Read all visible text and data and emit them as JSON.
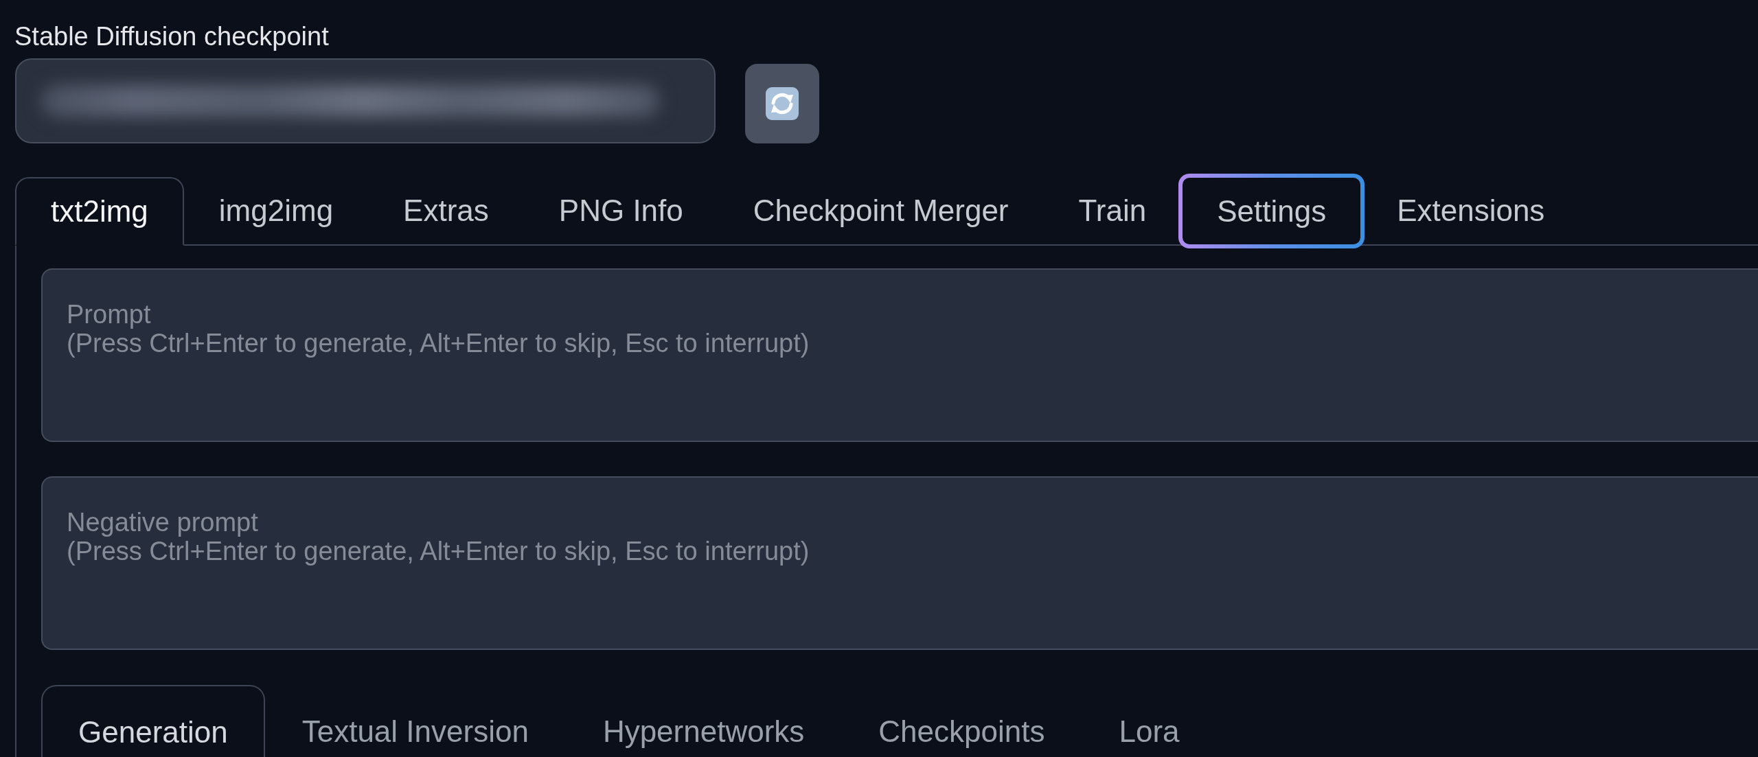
{
  "checkpoint": {
    "label": "Stable Diffusion checkpoint",
    "blurred": true
  },
  "tabs": [
    {
      "label": "txt2img",
      "selected": true,
      "highlighted": false
    },
    {
      "label": "img2img",
      "selected": false,
      "highlighted": false
    },
    {
      "label": "Extras",
      "selected": false,
      "highlighted": false
    },
    {
      "label": "PNG Info",
      "selected": false,
      "highlighted": false
    },
    {
      "label": "Checkpoint Merger",
      "selected": false,
      "highlighted": false
    },
    {
      "label": "Train",
      "selected": false,
      "highlighted": false
    },
    {
      "label": "Settings",
      "selected": false,
      "highlighted": true
    },
    {
      "label": "Extensions",
      "selected": false,
      "highlighted": false
    }
  ],
  "prompts": [
    {
      "placeholder": "Prompt\n(Press Ctrl+Enter to generate, Alt+Enter to skip, Esc to interrupt)"
    },
    {
      "placeholder": "Negative prompt\n(Press Ctrl+Enter to generate, Alt+Enter to skip, Esc to interrupt)"
    }
  ],
  "subtabs": [
    {
      "label": "Generation",
      "selected": true
    },
    {
      "label": "Textual Inversion",
      "selected": false
    },
    {
      "label": "Hypernetworks",
      "selected": false
    },
    {
      "label": "Checkpoints",
      "selected": false
    },
    {
      "label": "Lora",
      "selected": false
    }
  ]
}
